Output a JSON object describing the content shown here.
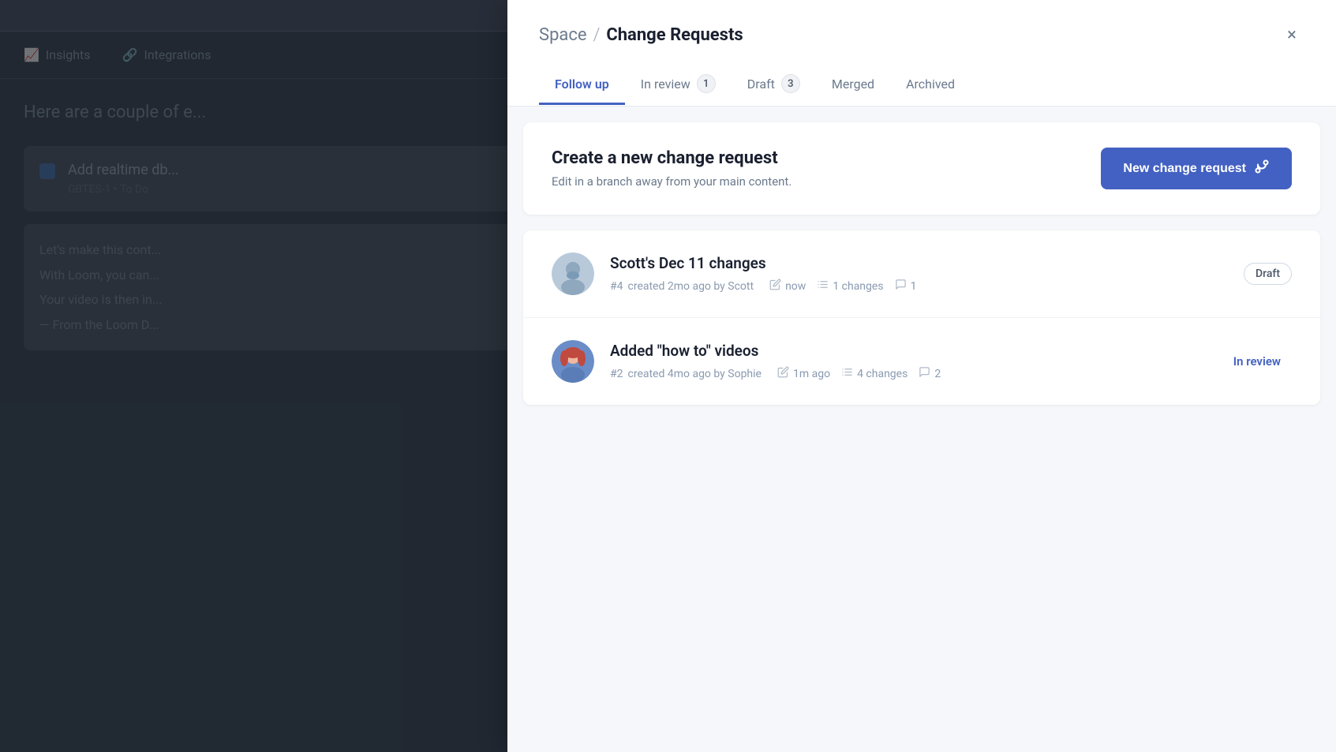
{
  "background": {
    "nav_items": [
      {
        "icon": "chart-icon",
        "label": "Insights"
      },
      {
        "icon": "integration-icon",
        "label": "Integrations"
      }
    ],
    "content_text": "Here are a couple of e...",
    "card1": {
      "title": "Add realtime db...",
      "sub": "GBTES-1  •  To Do"
    },
    "card2_lines": [
      "Let's make this cont...",
      "With Loom, you can...",
      "Your video is then in...",
      "— From the Loom D..."
    ]
  },
  "modal": {
    "breadcrumb_space": "Space",
    "breadcrumb_sep": "/",
    "breadcrumb_title": "Change Requests",
    "close_icon": "×",
    "tabs": [
      {
        "label": "Follow up",
        "active": true,
        "badge": null
      },
      {
        "label": "In review",
        "active": false,
        "badge": "1"
      },
      {
        "label": "Draft",
        "active": false,
        "badge": "3"
      },
      {
        "label": "Merged",
        "active": false,
        "badge": null
      },
      {
        "label": "Archived",
        "active": false,
        "badge": null
      }
    ],
    "cta": {
      "title": "Create a new change request",
      "subtitle": "Edit in a branch away from your main content.",
      "button_label": "New change request"
    },
    "items": [
      {
        "avatar_type": "scott",
        "title": "Scott's Dec 11 changes",
        "number": "#4",
        "created": "created 2mo ago by Scott",
        "edited": "now",
        "changes": "1 changes",
        "comments": "1",
        "badge": "Draft",
        "badge_type": "draft"
      },
      {
        "avatar_type": "sophie",
        "title": "Added \"how to\" videos",
        "number": "#2",
        "created": "created 4mo ago by Sophie",
        "edited": "1m ago",
        "changes": "4 changes",
        "comments": "2",
        "badge": "In review",
        "badge_type": "in-review"
      }
    ]
  }
}
